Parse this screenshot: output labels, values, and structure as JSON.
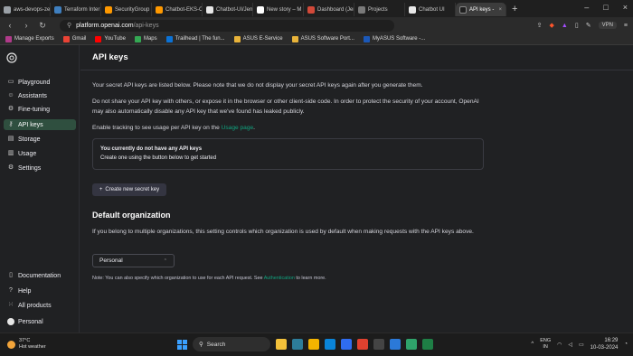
{
  "browser": {
    "tabs": [
      {
        "label": "aws-devops-ze",
        "color": "#9aa0a6",
        "active": false
      },
      {
        "label": "Terraform Inter",
        "color": "#3f7fbf",
        "active": false
      },
      {
        "label": "SecurityGroup",
        "color": "#ff9900",
        "active": false
      },
      {
        "label": "Chatbot-EKS-C",
        "color": "#ff9900",
        "active": false
      },
      {
        "label": "Chatbot-UI/Jen",
        "color": "#e8e8e8",
        "active": false
      },
      {
        "label": "New story – M",
        "color": "#ffffff",
        "active": false
      },
      {
        "label": "Dashboard (Jen",
        "color": "#d24939",
        "active": false
      },
      {
        "label": "Projects",
        "color": "#7a7a7a",
        "active": false
      },
      {
        "label": "Chatbot UI",
        "color": "#e8e8e8",
        "active": false
      },
      {
        "label": "API keys -",
        "color": "#1f1f1f",
        "active": true
      }
    ],
    "tab_close": "×",
    "new_tab": "+",
    "window_controls": [
      "–",
      "□",
      "×"
    ],
    "url_host": "platform.openai.com",
    "url_path": "/api-keys",
    "vpn_label": "VPN",
    "bookmarks": [
      {
        "label": "Manage Exports",
        "color": "#b03a8a"
      },
      {
        "label": "Gmail",
        "color": "#ea4335"
      },
      {
        "label": "YouTube",
        "color": "#ff0000"
      },
      {
        "label": "Maps",
        "color": "#34a853"
      },
      {
        "label": "Trailhead | The fun...",
        "color": "#0b72d6"
      },
      {
        "label": "ASUS E-Service",
        "color": "#e8b33a"
      },
      {
        "label": "ASUS Software Port...",
        "color": "#e8b33a"
      },
      {
        "label": "MyASUS Software -...",
        "color": "#1b58b8"
      }
    ]
  },
  "sidebar": {
    "items": [
      {
        "label": "Playground",
        "icon": "▭",
        "active": false
      },
      {
        "label": "Assistants",
        "icon": "☺",
        "active": false
      },
      {
        "label": "Fine-tuning",
        "icon": "⚙",
        "active": false
      },
      {
        "label": "API keys",
        "icon": "⚷",
        "active": true
      },
      {
        "label": "Storage",
        "icon": "▤",
        "active": false
      },
      {
        "label": "Usage",
        "icon": "▥",
        "active": false
      },
      {
        "label": "Settings",
        "icon": "⚙",
        "active": false
      }
    ],
    "bottom": [
      {
        "label": "Documentation",
        "icon": "▯"
      },
      {
        "label": "Help",
        "icon": "?"
      },
      {
        "label": "All products",
        "icon": "⁙"
      }
    ],
    "user": "Personal"
  },
  "main": {
    "title": "API keys",
    "p1": "Your secret API keys are listed below. Please note that we do not display your secret API keys again after you generate them.",
    "p2": "Do not share your API key with others, or expose it in the browser or other client-side code. In order to protect the security of your account, OpenAI may also automatically disable any API key that we've found has leaked publicly.",
    "p3_prefix": "Enable tracking to see usage per API key on the ",
    "p3_link": "Usage page",
    "p3_suffix": ".",
    "empty_title": "You currently do not have any API keys",
    "empty_sub": "Create one using the button below to get started",
    "create_button": "Create new secret key",
    "create_button_icon": "+",
    "org_heading": "Default organization",
    "org_desc": "If you belong to multiple organizations, this setting controls which organization is used by default when making requests with the API keys above.",
    "org_select_value": "Personal",
    "org_select_chevron": "⌃⌄",
    "note_prefix": "Note: You can also specify which organization to use for each API request. See ",
    "note_link": "Authentication",
    "note_suffix": " to learn more."
  },
  "taskbar": {
    "temp": "37°C",
    "weather": "Hot weather",
    "search_label": "Search",
    "apps": [
      "#f3c13a",
      "#2d7d9a",
      "#f4b400",
      "#0a84d8",
      "#2f6cf0",
      "#e0412f",
      "#444444",
      "#2b79d8",
      "#2fa36b",
      "#1e7e45"
    ],
    "lang1": "ENG",
    "lang2": "IN",
    "time": "16:29",
    "date": "10-03-2024",
    "tray_arrow": "^"
  }
}
